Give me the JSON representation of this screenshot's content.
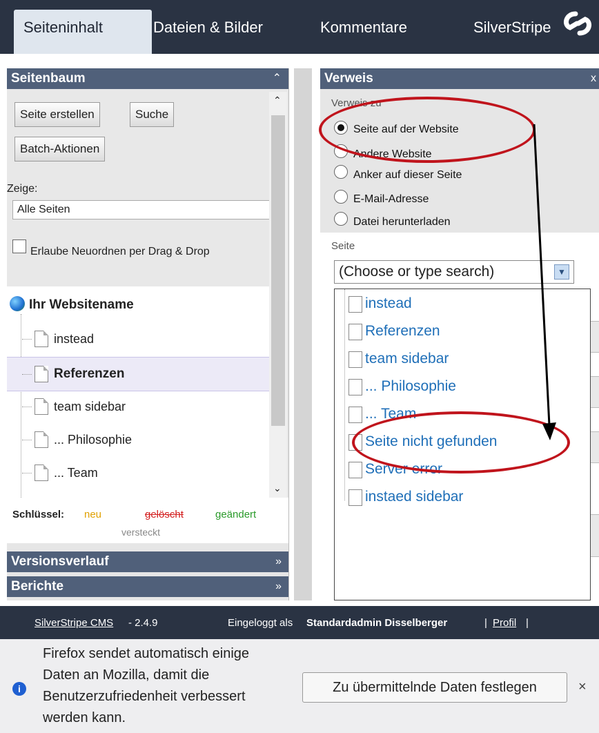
{
  "tabs": [
    "Seiteninhalt",
    "Dateien & Bilder",
    "Kommentare",
    "SilverStripe"
  ],
  "left": {
    "title": "Seitenbaum",
    "buttons": {
      "create": "Seite erstellen",
      "search": "Suche",
      "batch": "Batch-Aktionen"
    },
    "show_label": "Zeige:",
    "show_value": "Alle Seiten",
    "reorder_label": "Erlaube Neuordnen per Drag & Drop",
    "site_name": "Ihr Websitename",
    "tree": [
      "instead",
      "Referenzen",
      "team sidebar",
      "... Philosophie",
      "... Team"
    ],
    "key_label": "Schlüssel:",
    "key_new": "neu",
    "key_deleted": "gelöscht",
    "key_changed": "geändert",
    "key_hidden": "versteckt",
    "history": "Versionsverlauf",
    "reports": "Berichte",
    "colors": {
      "new": "#e0a000",
      "deleted": "#d32020",
      "changed": "#2a9a2a"
    }
  },
  "right": {
    "title": "Verweis",
    "close": "x",
    "link_to_label": "Verweis zu",
    "options": [
      "Seite auf der Website",
      "Andere Website",
      "Anker auf dieser Seite",
      "E-Mail-Adresse",
      "Datei herunterladen"
    ],
    "page_label": "Seite",
    "select_value": "(Choose or type search)",
    "dropdown": [
      "instead",
      "Referenzen",
      "team sidebar",
      "... Philosophie",
      "... Team",
      "Seite nicht gefunden",
      "Server error",
      "instaed sidebar"
    ]
  },
  "footer": {
    "cms": "SilverStripe CMS",
    "version": " - 2.4.9",
    "logged_in": "Eingeloggt als",
    "user": "Standardadmin Disselberger",
    "profile": "Profil"
  },
  "notification": {
    "message": "Firefox sendet automatisch einige Daten an Mozilla, damit die Benutzerzufriedenheit verbessert werden kann.",
    "button": "Zu übermittelnde Daten festlegen",
    "close": "×"
  }
}
